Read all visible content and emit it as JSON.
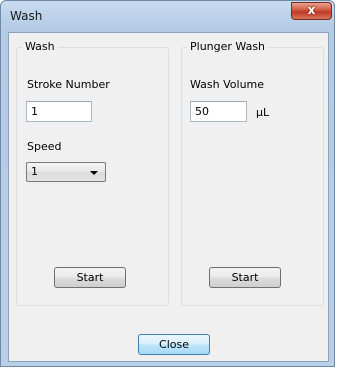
{
  "window": {
    "title": "Wash",
    "close_glyph": "x"
  },
  "wash_group": {
    "legend": "Wash",
    "stroke_label": "Stroke Number",
    "stroke_value": "1",
    "speed_label": "Speed",
    "speed_value": "1",
    "start_label": "Start"
  },
  "plunger_group": {
    "legend": "Plunger Wash",
    "volume_label": "Wash Volume",
    "volume_value": "50",
    "volume_unit": "μL",
    "start_label": "Start"
  },
  "footer": {
    "close_label": "Close"
  }
}
